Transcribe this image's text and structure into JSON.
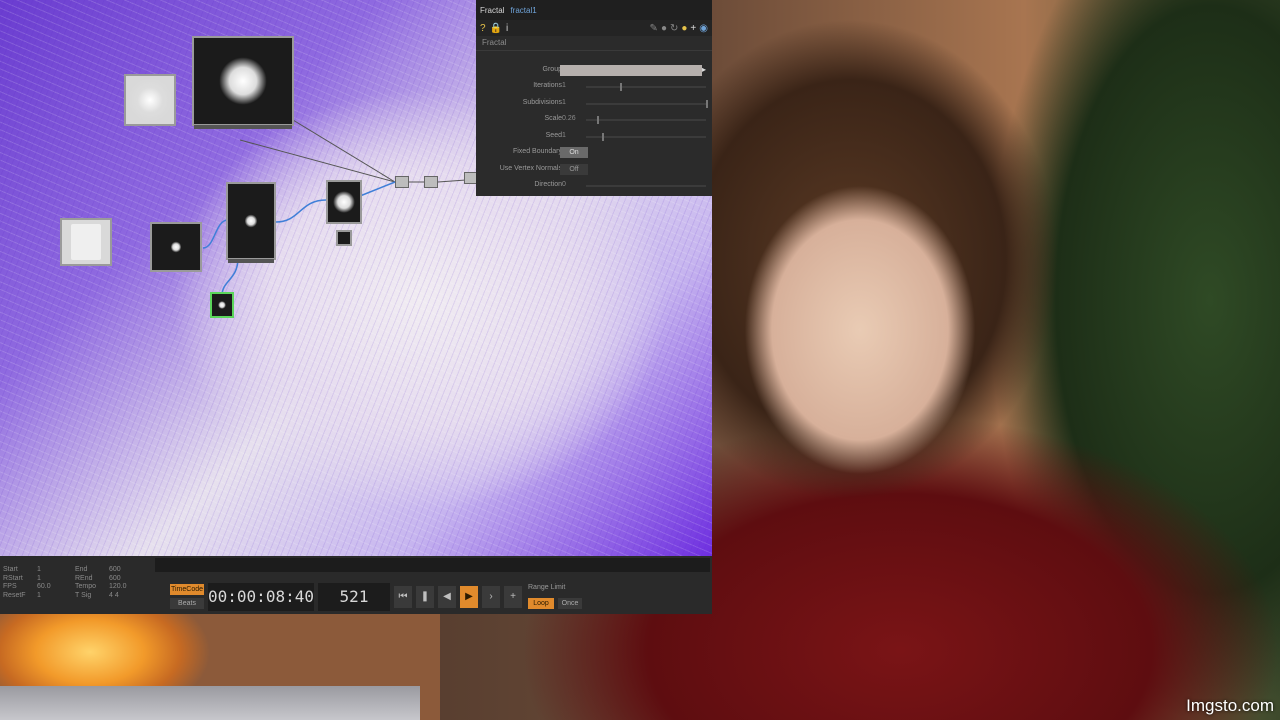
{
  "parameter_panel": {
    "operator_type": "Fractal",
    "operator_name": "fractal1",
    "page_tab": "Fractal",
    "params": [
      {
        "label": "Group",
        "kind": "field",
        "value": ""
      },
      {
        "label": "Iterations",
        "kind": "slider",
        "value": "1"
      },
      {
        "label": "Subdivisions",
        "kind": "slider",
        "value": "1"
      },
      {
        "label": "Scale",
        "kind": "slider",
        "value": "0.26"
      },
      {
        "label": "Seed",
        "kind": "slider",
        "value": "1"
      },
      {
        "label": "Fixed Boundary",
        "kind": "toggle",
        "value": "On"
      },
      {
        "label": "Use Vertex Normals",
        "kind": "toggle",
        "value": "Off"
      },
      {
        "label": "Direction",
        "kind": "slider",
        "value": "0"
      }
    ]
  },
  "timeline": {
    "stats": {
      "labels_left": [
        "Start",
        "RStart",
        "FPS",
        "ResetF"
      ],
      "values_left": [
        "1",
        "1",
        "60.0",
        "1"
      ],
      "labels_right": [
        "End",
        "REnd",
        "Tempo",
        "T Sig"
      ],
      "values_right": [
        "600",
        "600",
        "120.0",
        "4   4"
      ]
    },
    "timecode_label": "TimeCode",
    "beats_label": "Beats",
    "timecode": "00:00:08:40",
    "frame": "521",
    "range_label": "Range Limit",
    "loop_label": "Loop",
    "once_label": "Once"
  },
  "watermark": "Imgsto.com"
}
